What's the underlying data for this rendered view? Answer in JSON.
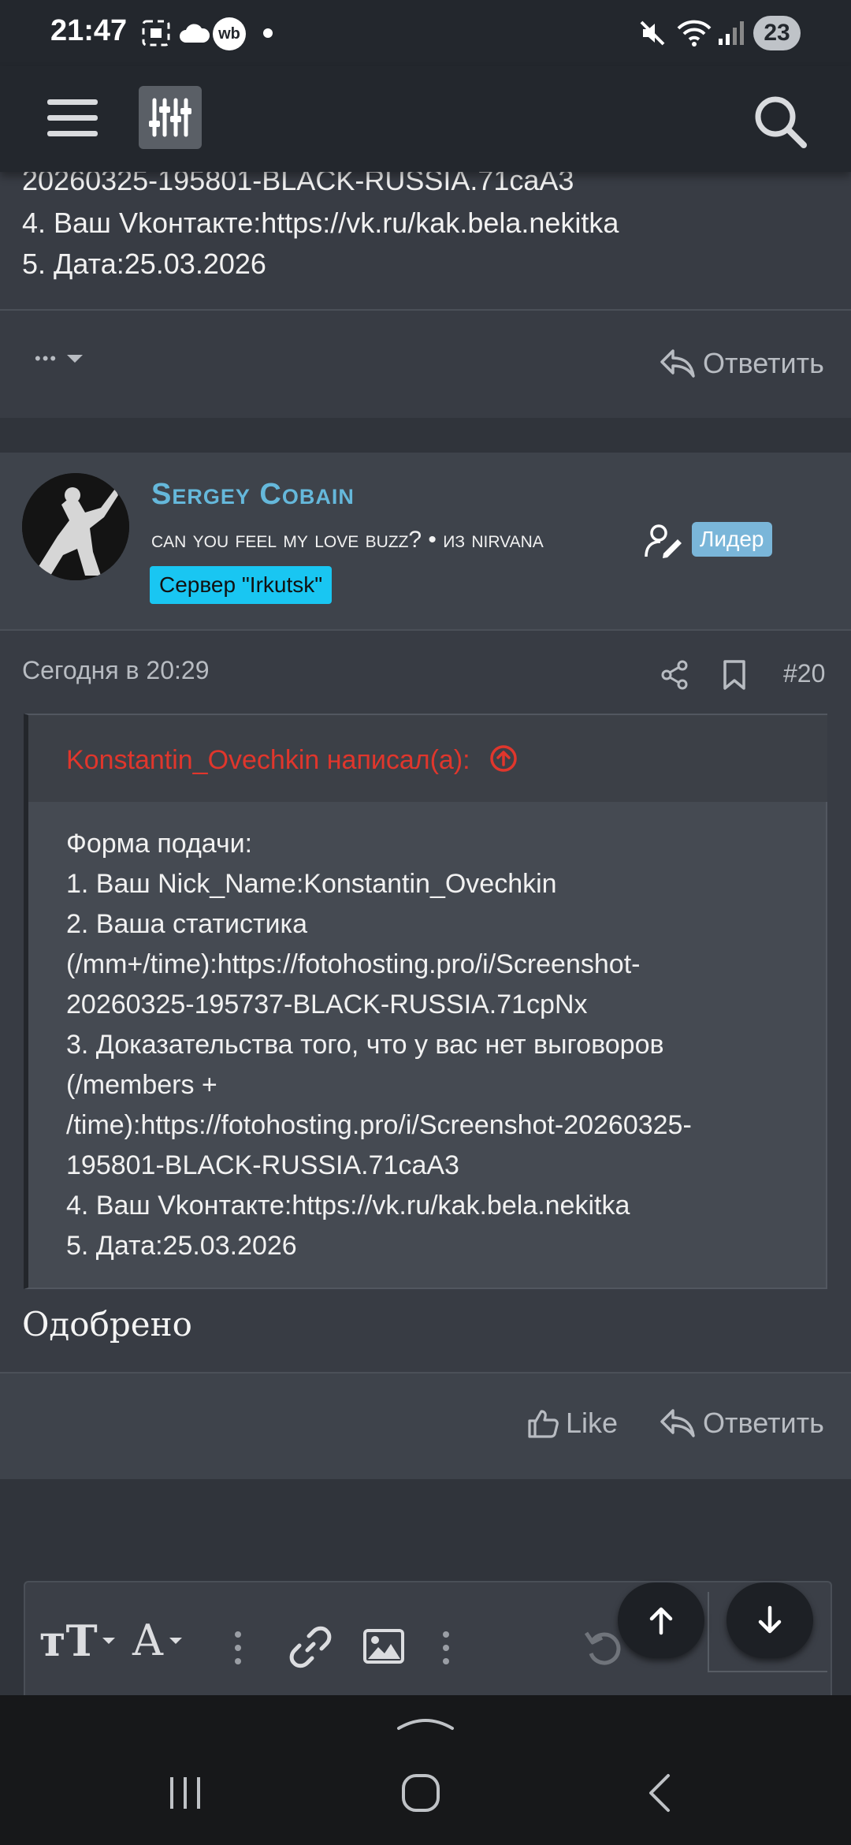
{
  "status_bar": {
    "time": "21:47",
    "wb_label": "wb",
    "battery": "23",
    "icons": [
      "screenshot-icon",
      "cloud-icon",
      "wb-icon",
      "dot-icon",
      "mute-icon",
      "wifi-icon",
      "signal-icon",
      "battery-icon"
    ]
  },
  "header": {
    "icons": [
      "menu-icon",
      "filter-mixer-icon",
      "search-icon"
    ]
  },
  "post_prev": {
    "lines": [
      "20260325-195801-BLACK-RUSSIA.71caA3",
      "4. Ваш Vkонтакте:https://vk.ru/kak.bela.nekitka",
      "5. Дата:25.03.2026"
    ],
    "more": "•••",
    "reply_label": "Ответить"
  },
  "post": {
    "author": "Sergey Cobain",
    "user_title": "can you feel my love buzz? • из nirvana",
    "leader_badge": "Лидер",
    "server_badge": "Сервер \"Irkutsk\"",
    "date": "Сегодня в 20:29",
    "number": "#20",
    "quote_author": "Konstantin_Ovechkin написал(а):",
    "quote_lines": [
      "Форма подачи:",
      "1. Ваш Nick_Name:Konstantin_Ovechkin",
      "2. Ваша статистика",
      "(/mm+/time):https://fotohosting.pro/i/Screenshot-",
      "20260325-195737-BLACK-RUSSIA.71cpNx",
      "3. Доказательства того, что у вас нет выговоров",
      "(/members +",
      "/time):https://fotohosting.pro/i/Screenshot-20260325-",
      "195801-BLACK-RUSSIA.71caA3",
      "4. Ваш Vkонтакте:https://vk.ru/kak.bela.nekitka",
      "5. Дата:25.03.2026"
    ],
    "body": "Одобрено",
    "like_label": "Like",
    "reply_label": "Ответить"
  },
  "editor": {
    "text_size_label": "тT",
    "font_label": "A"
  },
  "colors": {
    "header_bg": "#23272d",
    "page_bg": "#30343b",
    "username": "#65b8db",
    "leader": "#7ab6d9",
    "server": "#19c6f2",
    "quote_author": "#e0362c"
  }
}
